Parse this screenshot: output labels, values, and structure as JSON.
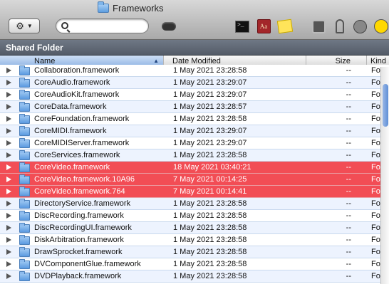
{
  "window": {
    "title": "Frameworks"
  },
  "toolbar": {
    "action_button_glyph": "⚙",
    "search_placeholder": "",
    "icons": [
      "gear-icon",
      "search-icon",
      "eject-icon",
      "terminal-icon",
      "dictionary-icon",
      "stickies-icon",
      "system-preferences-icon",
      "keychain-icon",
      "utility-icon",
      "radiation-icon"
    ]
  },
  "path": {
    "label": "Shared Folder"
  },
  "columns": {
    "name": "Name",
    "date": "Date Modified",
    "size": "Size",
    "kind": "Kind"
  },
  "colors": {
    "label_red": "#f24d55",
    "alt_row": "#edf3fe",
    "selection_header": "#8fb3e3"
  },
  "files": [
    {
      "name": "Collaboration.framework",
      "date": "1 May 2021 23:28:58",
      "size": "--",
      "kind": "Folder",
      "label": false
    },
    {
      "name": "CoreAudio.framework",
      "date": "1 May 2021 23:29:07",
      "size": "--",
      "kind": "Folder",
      "label": false
    },
    {
      "name": "CoreAudioKit.framework",
      "date": "1 May 2021 23:29:07",
      "size": "--",
      "kind": "Folder",
      "label": false
    },
    {
      "name": "CoreData.framework",
      "date": "1 May 2021 23:28:57",
      "size": "--",
      "kind": "Folder",
      "label": false
    },
    {
      "name": "CoreFoundation.framework",
      "date": "1 May 2021 23:28:58",
      "size": "--",
      "kind": "Folder",
      "label": false
    },
    {
      "name": "CoreMIDI.framework",
      "date": "1 May 2021 23:29:07",
      "size": "--",
      "kind": "Folder",
      "label": false
    },
    {
      "name": "CoreMIDIServer.framework",
      "date": "1 May 2021 23:29:07",
      "size": "--",
      "kind": "Folder",
      "label": false
    },
    {
      "name": "CoreServices.framework",
      "date": "1 May 2021 23:28:58",
      "size": "--",
      "kind": "Folder",
      "label": false
    },
    {
      "name": "CoreVideo.framework",
      "date": "18 May 2021 03:40:21",
      "size": "--",
      "kind": "Folder",
      "label": true
    },
    {
      "name": "CoreVideo.framework.10A96",
      "date": "7 May 2021 00:14:25",
      "size": "--",
      "kind": "Folder",
      "label": true
    },
    {
      "name": "CoreVideo.framework.764",
      "date": "7 May 2021 00:14:41",
      "size": "--",
      "kind": "Folder",
      "label": true
    },
    {
      "name": "DirectoryService.framework",
      "date": "1 May 2021 23:28:58",
      "size": "--",
      "kind": "Folder",
      "label": false
    },
    {
      "name": "DiscRecording.framework",
      "date": "1 May 2021 23:28:58",
      "size": "--",
      "kind": "Folder",
      "label": false
    },
    {
      "name": "DiscRecordingUI.framework",
      "date": "1 May 2021 23:28:58",
      "size": "--",
      "kind": "Folder",
      "label": false
    },
    {
      "name": "DiskArbitration.framework",
      "date": "1 May 2021 23:28:58",
      "size": "--",
      "kind": "Folder",
      "label": false
    },
    {
      "name": "DrawSprocket.framework",
      "date": "1 May 2021 23:28:58",
      "size": "--",
      "kind": "Folder",
      "label": false
    },
    {
      "name": "DVComponentGlue.framework",
      "date": "1 May 2021 23:28:58",
      "size": "--",
      "kind": "Folder",
      "label": false
    },
    {
      "name": "DVDPlayback.framework",
      "date": "1 May 2021 23:28:58",
      "size": "--",
      "kind": "Folder",
      "label": false
    }
  ]
}
